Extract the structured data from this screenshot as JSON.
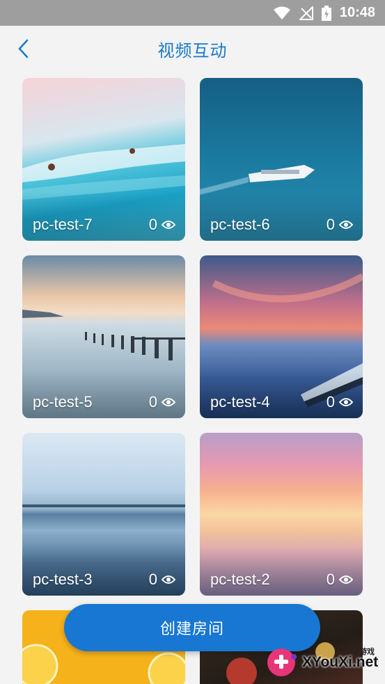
{
  "status_bar": {
    "time": "10:48"
  },
  "header": {
    "title": "视频互动"
  },
  "rooms": [
    {
      "name": "pc-test-7",
      "views": "0"
    },
    {
      "name": "pc-test-6",
      "views": "0"
    },
    {
      "name": "pc-test-5",
      "views": "0"
    },
    {
      "name": "pc-test-4",
      "views": "0"
    },
    {
      "name": "pc-test-3",
      "views": "0"
    },
    {
      "name": "pc-test-2",
      "views": "0"
    },
    {
      "name": "",
      "views": ""
    },
    {
      "name": "",
      "views": ""
    }
  ],
  "create_button": {
    "label": "创建房间"
  },
  "watermark": {
    "small": "X游戏",
    "text": "XYouXi.net"
  },
  "colors": {
    "accent": "#1877d2",
    "title": "#1778cf",
    "status_bar": "#9e9e9e"
  },
  "icons": {
    "back": "chevron-left-icon",
    "views": "eye-icon",
    "wifi": "wifi-icon",
    "signal": "no-signal-icon",
    "battery": "battery-charging-icon"
  }
}
